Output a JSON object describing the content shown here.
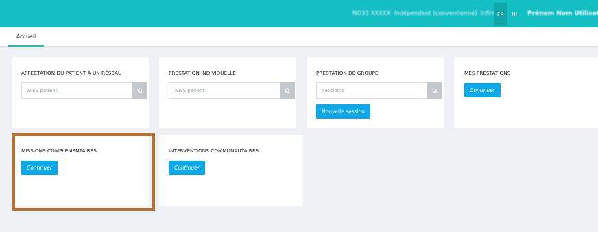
{
  "header": {
    "user_info": [
      "NO33 XXXXX",
      "Indépendant (conventionné)",
      "Infirmier"
    ],
    "languages": [
      "FR",
      "NL"
    ],
    "user_name": "Prénom Nom Utilisateur"
  },
  "tabs": [
    {
      "label": "Accueil"
    }
  ],
  "cards": {
    "affectation": {
      "title": "AFFECTATION DU PATIENT À UN RÉSEAU",
      "search_placeholder": "NISS patient"
    },
    "prestation_individuelle": {
      "title": "PRESTATION INDIVIDUELLE",
      "search_placeholder": "NISS patient"
    },
    "prestation_groupe": {
      "title": "PRESTATION DE GROUPE",
      "search_placeholder": "sessionId",
      "new_session_label": "Nouvelle session"
    },
    "mes_prestations": {
      "title": "MES PRESTATIONS",
      "continue_label": "Continuer"
    },
    "missions": {
      "title": "MISSIONS COMPLÉMENTAIRES",
      "continue_label": "Continuer"
    },
    "interventions": {
      "title": "INTERVENTIONS COMMUNAUTAIRES",
      "continue_label": "Continuer"
    }
  },
  "colors": {
    "topbar": "#14bfc3",
    "primary_button": "#0ba9e9",
    "highlight_border": "#b9722e"
  },
  "icons": {
    "search": "magnifier-icon"
  }
}
